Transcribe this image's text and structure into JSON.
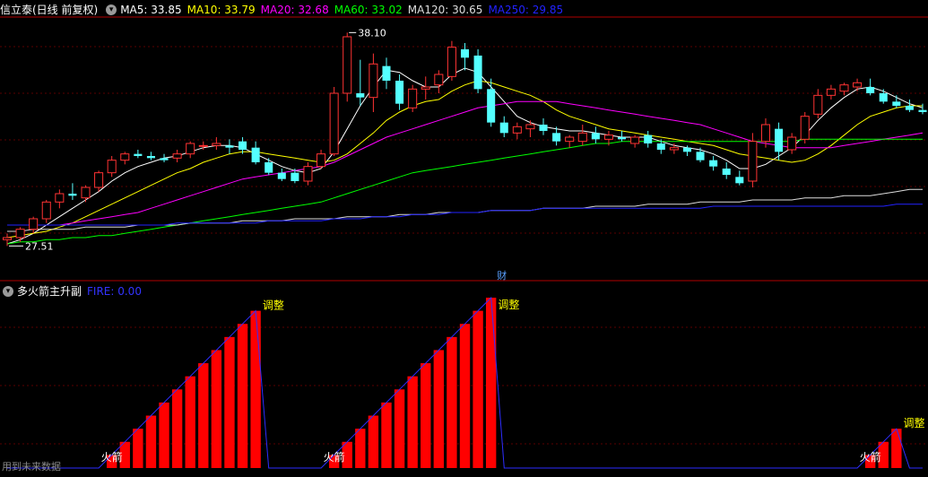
{
  "price_panel": {
    "title": "信立泰(日线 前复权)",
    "ma_legend": [
      {
        "label": "MA5: 33.85",
        "color": "#ffffff"
      },
      {
        "label": "MA10: 33.79",
        "color": "#ffff00"
      },
      {
        "label": "MA20: 32.68",
        "color": "#ff00ff"
      },
      {
        "label": "MA60: 33.02",
        "color": "#00ff00"
      },
      {
        "label": "MA120: 30.65",
        "color": "#dddddd"
      },
      {
        "label": "MA250: 29.85",
        "color": "#2222ff"
      }
    ],
    "high_label": "38.10",
    "low_label": "27.51",
    "finance_marker": "财"
  },
  "indicator_panel": {
    "title": "多火箭主升副",
    "value_label": "FIRE: 0.00",
    "value_color": "#3333ff",
    "annotations": {
      "rocket": "火箭",
      "adjust": "调整"
    }
  },
  "footer": "用到未来数据",
  "colors": {
    "up": "#ff3333",
    "down": "#54ffff",
    "bar": "#ff0000",
    "grid": "#5a0000",
    "separator": "#b00000"
  },
  "chart_data": {
    "type": "candlestick",
    "candles": [
      [
        28.2,
        28.5,
        27.9,
        28.3
      ],
      [
        28.3,
        28.8,
        28.1,
        28.7
      ],
      [
        28.7,
        29.3,
        28.5,
        29.2
      ],
      [
        29.2,
        30.1,
        29.0,
        30.0
      ],
      [
        30.0,
        30.6,
        29.7,
        30.4
      ],
      [
        30.4,
        30.9,
        30.1,
        30.3
      ],
      [
        30.2,
        30.8,
        30.0,
        30.7
      ],
      [
        30.7,
        31.5,
        30.5,
        31.4
      ],
      [
        31.4,
        32.2,
        31.2,
        32.0
      ],
      [
        32.0,
        32.4,
        31.8,
        32.3
      ],
      [
        32.3,
        32.5,
        32.1,
        32.2
      ],
      [
        32.2,
        32.4,
        32.0,
        32.1
      ],
      [
        32.1,
        32.3,
        31.9,
        32.0
      ],
      [
        32.1,
        32.5,
        31.9,
        32.3
      ],
      [
        32.3,
        32.9,
        32.1,
        32.8
      ],
      [
        32.7,
        32.9,
        32.5,
        32.7
      ],
      [
        32.7,
        33.1,
        32.5,
        32.8
      ],
      [
        32.7,
        33.0,
        32.3,
        32.6
      ],
      [
        32.9,
        33.1,
        32.3,
        32.5
      ],
      [
        32.6,
        32.9,
        31.8,
        31.9
      ],
      [
        31.9,
        32.1,
        31.3,
        31.4
      ],
      [
        31.4,
        31.6,
        31.0,
        31.1
      ],
      [
        31.4,
        31.6,
        30.9,
        31.0
      ],
      [
        31.0,
        31.9,
        30.8,
        31.7
      ],
      [
        31.7,
        32.5,
        31.6,
        32.3
      ],
      [
        32.3,
        35.5,
        32.2,
        35.2
      ],
      [
        35.2,
        38.1,
        34.8,
        37.9
      ],
      [
        35.2,
        36.8,
        34.6,
        35.0
      ],
      [
        35.0,
        37.1,
        34.3,
        36.6
      ],
      [
        36.5,
        36.9,
        35.4,
        35.8
      ],
      [
        35.8,
        36.1,
        34.4,
        34.7
      ],
      [
        34.5,
        35.6,
        34.3,
        35.4
      ],
      [
        35.4,
        36.0,
        34.9,
        35.5
      ],
      [
        35.6,
        36.3,
        35.2,
        36.1
      ],
      [
        36.0,
        37.7,
        35.8,
        37.4
      ],
      [
        37.3,
        37.6,
        36.3,
        36.9
      ],
      [
        37.0,
        37.3,
        35.2,
        35.4
      ],
      [
        35.4,
        35.9,
        33.6,
        33.8
      ],
      [
        33.8,
        34.1,
        33.1,
        33.3
      ],
      [
        33.3,
        33.8,
        33.0,
        33.6
      ],
      [
        33.5,
        33.9,
        33.1,
        33.7
      ],
      [
        33.7,
        34.0,
        33.2,
        33.4
      ],
      [
        33.3,
        33.6,
        32.7,
        32.9
      ],
      [
        32.9,
        33.2,
        32.6,
        33.1
      ],
      [
        32.9,
        33.7,
        32.7,
        33.3
      ],
      [
        33.3,
        33.6,
        32.8,
        33.0
      ],
      [
        33.0,
        33.4,
        32.7,
        33.2
      ],
      [
        33.1,
        33.4,
        32.9,
        33.0
      ],
      [
        32.8,
        33.2,
        32.6,
        33.1
      ],
      [
        33.2,
        33.4,
        32.6,
        32.8
      ],
      [
        32.8,
        33.0,
        32.3,
        32.5
      ],
      [
        32.5,
        32.8,
        32.3,
        32.6
      ],
      [
        32.6,
        32.7,
        32.2,
        32.4
      ],
      [
        32.4,
        32.6,
        31.9,
        32.0
      ],
      [
        32.0,
        32.2,
        31.5,
        31.7
      ],
      [
        31.6,
        31.9,
        31.1,
        31.3
      ],
      [
        31.2,
        31.5,
        30.8,
        30.9
      ],
      [
        31.0,
        33.3,
        30.7,
        32.9
      ],
      [
        32.9,
        34.0,
        32.6,
        33.7
      ],
      [
        33.5,
        33.8,
        32.0,
        32.4
      ],
      [
        32.5,
        33.3,
        32.3,
        33.1
      ],
      [
        33.0,
        34.3,
        32.8,
        34.1
      ],
      [
        34.2,
        35.4,
        34.0,
        35.1
      ],
      [
        35.1,
        35.6,
        34.9,
        35.4
      ],
      [
        35.3,
        35.7,
        35.1,
        35.6
      ],
      [
        35.5,
        35.9,
        35.3,
        35.7
      ],
      [
        35.5,
        35.9,
        35.1,
        35.2
      ],
      [
        35.2,
        35.4,
        34.7,
        34.8
      ],
      [
        34.8,
        35.1,
        34.5,
        34.6
      ],
      [
        34.6,
        34.9,
        34.3,
        34.4
      ],
      [
        34.4,
        34.7,
        34.2,
        34.3
      ]
    ],
    "ma_series": [
      {
        "name": "MA5",
        "color": "#ffffff",
        "values": [
          28.0,
          28.2,
          28.5,
          28.9,
          29.3,
          29.7,
          30.1,
          30.5,
          31.0,
          31.4,
          31.7,
          31.9,
          32.1,
          32.2,
          32.4,
          32.6,
          32.7,
          32.7,
          32.6,
          32.3,
          32.0,
          31.7,
          31.5,
          31.4,
          31.6,
          32.4,
          33.5,
          34.6,
          35.5,
          36.3,
          36.2,
          35.8,
          35.5,
          35.5,
          36.1,
          36.4,
          36.2,
          35.5,
          34.8,
          34.1,
          33.8,
          33.6,
          33.5,
          33.4,
          33.4,
          33.3,
          33.2,
          33.1,
          33.1,
          33.1,
          32.9,
          32.7,
          32.6,
          32.5,
          32.3,
          32.0,
          31.6,
          31.6,
          31.8,
          32.2,
          32.6,
          33.2,
          33.9,
          34.5,
          35.0,
          35.4,
          35.5,
          35.3,
          35.0,
          34.7,
          34.5
        ]
      },
      {
        "name": "MA10",
        "color": "#ffff00",
        "values": [
          28.3,
          28.4,
          28.5,
          28.6,
          28.8,
          29.0,
          29.3,
          29.6,
          29.9,
          30.2,
          30.5,
          30.8,
          31.1,
          31.4,
          31.6,
          31.9,
          32.1,
          32.3,
          32.4,
          32.4,
          32.3,
          32.2,
          32.1,
          32.0,
          31.9,
          32.0,
          32.3,
          32.8,
          33.3,
          33.9,
          34.3,
          34.6,
          34.8,
          34.9,
          35.3,
          35.6,
          35.8,
          35.7,
          35.5,
          35.3,
          35.1,
          34.8,
          34.4,
          34.1,
          33.9,
          33.7,
          33.5,
          33.4,
          33.3,
          33.2,
          33.1,
          33.0,
          32.9,
          32.8,
          32.7,
          32.5,
          32.3,
          32.2,
          32.1,
          32.0,
          31.9,
          32.0,
          32.3,
          32.7,
          33.2,
          33.7,
          34.1,
          34.3,
          34.5,
          34.6,
          34.6
        ]
      },
      {
        "name": "MA20",
        "color": "#ff00ff",
        "values": [
          28.9,
          28.9,
          28.9,
          28.9,
          28.9,
          29.0,
          29.1,
          29.2,
          29.3,
          29.4,
          29.5,
          29.7,
          29.9,
          30.1,
          30.3,
          30.5,
          30.7,
          30.9,
          31.1,
          31.2,
          31.3,
          31.4,
          31.5,
          31.6,
          31.7,
          31.9,
          32.2,
          32.5,
          32.8,
          33.1,
          33.3,
          33.5,
          33.7,
          33.9,
          34.1,
          34.3,
          34.5,
          34.6,
          34.7,
          34.8,
          34.8,
          34.8,
          34.8,
          34.7,
          34.6,
          34.5,
          34.4,
          34.3,
          34.2,
          34.1,
          34.0,
          33.9,
          33.8,
          33.7,
          33.5,
          33.3,
          33.1,
          32.9,
          32.8,
          32.7,
          32.6,
          32.6,
          32.6,
          32.6,
          32.7,
          32.8,
          32.9,
          33.0,
          33.1,
          33.2,
          33.3
        ]
      },
      {
        "name": "MA60",
        "color": "#00ff00",
        "values": [
          28.0,
          28.1,
          28.1,
          28.2,
          28.2,
          28.3,
          28.3,
          28.4,
          28.4,
          28.5,
          28.6,
          28.7,
          28.8,
          28.9,
          29.0,
          29.1,
          29.2,
          29.3,
          29.4,
          29.5,
          29.6,
          29.7,
          29.8,
          29.9,
          30.0,
          30.2,
          30.4,
          30.6,
          30.8,
          31.0,
          31.2,
          31.4,
          31.5,
          31.6,
          31.7,
          31.8,
          31.9,
          32.0,
          32.1,
          32.2,
          32.3,
          32.4,
          32.5,
          32.6,
          32.7,
          32.8,
          32.8,
          32.9,
          32.9,
          32.9,
          32.9,
          32.9,
          32.9,
          32.9,
          32.9,
          32.9,
          32.9,
          32.9,
          32.9,
          32.9,
          32.9,
          33.0,
          33.0,
          33.0,
          33.0,
          33.0,
          33.0,
          33.0,
          33.0,
          33.0,
          33.0
        ]
      },
      {
        "name": "MA120",
        "color": "#dddddd",
        "values": [
          28.6,
          28.6,
          28.7,
          28.7,
          28.7,
          28.7,
          28.8,
          28.8,
          28.8,
          28.8,
          28.9,
          28.9,
          28.9,
          28.9,
          29.0,
          29.0,
          29.0,
          29.0,
          29.1,
          29.1,
          29.1,
          29.1,
          29.2,
          29.2,
          29.2,
          29.2,
          29.3,
          29.3,
          29.3,
          29.3,
          29.4,
          29.4,
          29.4,
          29.5,
          29.5,
          29.5,
          29.5,
          29.6,
          29.6,
          29.6,
          29.6,
          29.7,
          29.7,
          29.7,
          29.7,
          29.8,
          29.8,
          29.8,
          29.8,
          29.9,
          29.9,
          29.9,
          29.9,
          30.0,
          30.0,
          30.0,
          30.0,
          30.1,
          30.1,
          30.1,
          30.1,
          30.2,
          30.2,
          30.2,
          30.3,
          30.3,
          30.3,
          30.4,
          30.5,
          30.6,
          30.6
        ]
      },
      {
        "name": "MA250",
        "color": "#2222ff",
        "values": [
          28.9,
          28.9,
          28.9,
          28.9,
          28.9,
          28.9,
          28.9,
          28.9,
          28.9,
          28.9,
          28.9,
          28.9,
          28.9,
          29.0,
          29.0,
          29.0,
          29.0,
          29.0,
          29.0,
          29.0,
          29.1,
          29.1,
          29.1,
          29.1,
          29.1,
          29.2,
          29.2,
          29.2,
          29.3,
          29.3,
          29.3,
          29.4,
          29.4,
          29.4,
          29.5,
          29.5,
          29.5,
          29.6,
          29.6,
          29.6,
          29.6,
          29.7,
          29.7,
          29.7,
          29.7,
          29.7,
          29.7,
          29.7,
          29.7,
          29.7,
          29.7,
          29.7,
          29.7,
          29.7,
          29.8,
          29.8,
          29.8,
          29.8,
          29.8,
          29.8,
          29.8,
          29.8,
          29.8,
          29.8,
          29.8,
          29.8,
          29.8,
          29.8,
          29.9,
          29.9,
          29.9
        ]
      }
    ],
    "fire_bars": [
      0,
      0,
      0,
      0,
      0,
      0,
      0,
      0,
      1,
      2,
      3,
      4,
      5,
      6,
      7,
      8,
      9,
      10,
      11,
      12,
      0,
      0,
      0,
      0,
      0,
      1,
      2,
      3,
      4,
      5,
      6,
      7,
      8,
      9,
      10,
      11,
      12,
      13,
      0,
      0,
      0,
      0,
      0,
      0,
      0,
      0,
      0,
      0,
      0,
      0,
      0,
      0,
      0,
      0,
      0,
      0,
      0,
      0,
      0,
      0,
      0,
      0,
      0,
      0,
      0,
      0,
      1,
      2,
      3,
      0,
      0
    ],
    "fire_labels": [
      {
        "bar": 8,
        "text": "火箭"
      },
      {
        "bar": 19,
        "text": "调整"
      },
      {
        "bar": 25,
        "text": "火箭"
      },
      {
        "bar": 37,
        "text": "调整"
      },
      {
        "bar": 66,
        "text": "火箭"
      },
      {
        "bar": 68,
        "text": "调整"
      }
    ],
    "ylim": [
      26.8,
      38.8
    ]
  }
}
